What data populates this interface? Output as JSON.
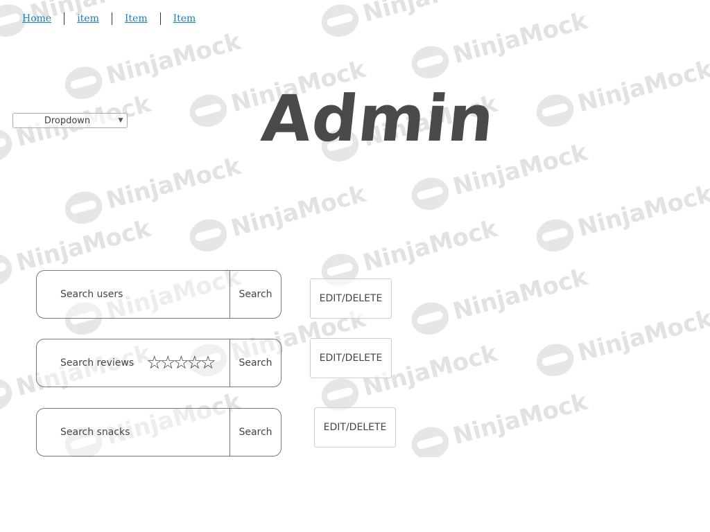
{
  "breadcrumb": {
    "items": [
      {
        "label": "Home"
      },
      {
        "label": "item"
      },
      {
        "label": "Item"
      },
      {
        "label": "Item"
      }
    ]
  },
  "dropdown": {
    "selected": "Dropdown"
  },
  "page": {
    "title": "Admin"
  },
  "watermark": {
    "text": "NinjaMock"
  },
  "searches": [
    {
      "placeholder": "Search users",
      "button": "Search",
      "action": "EDIT/DELETE"
    },
    {
      "placeholder": "Search reviews",
      "rating": "☆☆☆☆☆",
      "button": "Search",
      "action": "EDIT/DELETE"
    },
    {
      "placeholder": "Search snacks",
      "button": "Search",
      "action": "EDIT/DELETE"
    }
  ],
  "colors": {
    "link": "#1a7fc0",
    "title": "#4a4a4a",
    "border": "#777777",
    "watermark": "#e2e2e2"
  }
}
